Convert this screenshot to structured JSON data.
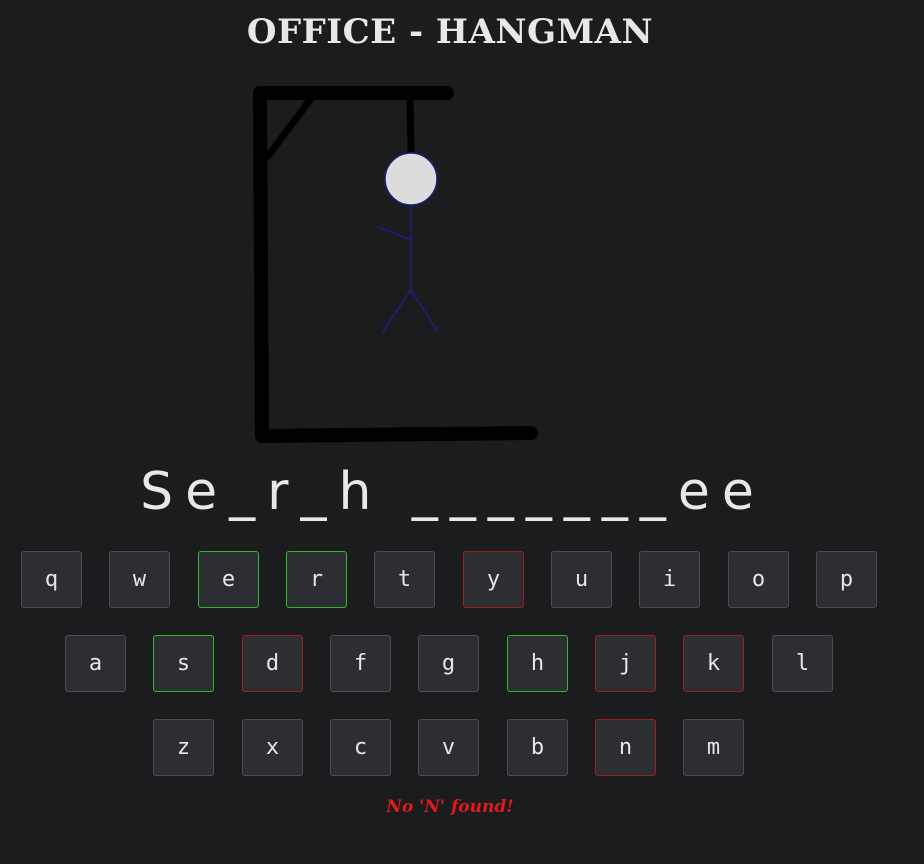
{
  "title": "OFFICE - HANGMAN",
  "word_display": "Se_r_h _______ee",
  "keyboard": {
    "rows": [
      [
        {
          "letter": "q",
          "state": "unused"
        },
        {
          "letter": "w",
          "state": "unused"
        },
        {
          "letter": "e",
          "state": "correct"
        },
        {
          "letter": "r",
          "state": "correct"
        },
        {
          "letter": "t",
          "state": "unused"
        },
        {
          "letter": "y",
          "state": "wrong"
        },
        {
          "letter": "u",
          "state": "unused"
        },
        {
          "letter": "i",
          "state": "unused"
        },
        {
          "letter": "o",
          "state": "unused"
        },
        {
          "letter": "p",
          "state": "unused"
        }
      ],
      [
        {
          "letter": "a",
          "state": "unused"
        },
        {
          "letter": "s",
          "state": "correct"
        },
        {
          "letter": "d",
          "state": "wrong"
        },
        {
          "letter": "f",
          "state": "unused"
        },
        {
          "letter": "g",
          "state": "unused"
        },
        {
          "letter": "h",
          "state": "correct"
        },
        {
          "letter": "j",
          "state": "wrong"
        },
        {
          "letter": "k",
          "state": "wrong"
        },
        {
          "letter": "l",
          "state": "unused"
        }
      ],
      [
        {
          "letter": "z",
          "state": "unused"
        },
        {
          "letter": "x",
          "state": "unused"
        },
        {
          "letter": "c",
          "state": "unused"
        },
        {
          "letter": "v",
          "state": "unused"
        },
        {
          "letter": "b",
          "state": "unused"
        },
        {
          "letter": "n",
          "state": "wrong"
        },
        {
          "letter": "m",
          "state": "unused"
        }
      ]
    ]
  },
  "message": "No 'N' found!",
  "colors": {
    "background": "#1b1c1e",
    "correct": "#2fb52f",
    "wrong": "#a11d1d",
    "message": "#e21a1a",
    "figure": "#1a1f7a",
    "head_fill": "#dcdcdc"
  }
}
